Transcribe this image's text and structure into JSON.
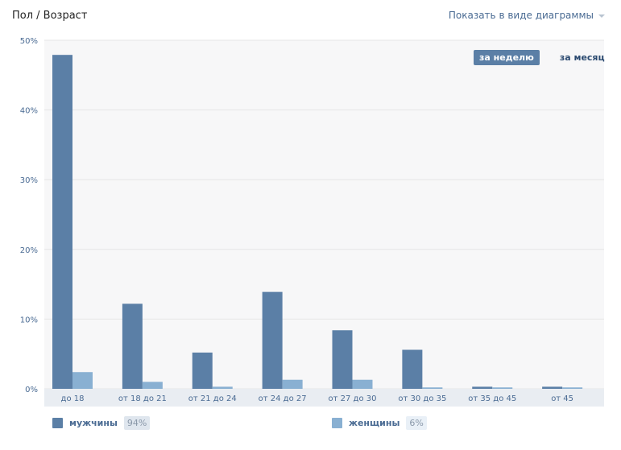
{
  "header": {
    "title": "Пол / Возраст",
    "view_toggle_label": "Показать в виде диаграммы"
  },
  "tabs": [
    {
      "label": "за неделю",
      "active": true
    },
    {
      "label": "за месяц",
      "active": false
    }
  ],
  "chart_data": {
    "type": "bar",
    "categories": [
      "до 18",
      "от 18 до 21",
      "от 21 до 24",
      "от 24 до 27",
      "от 27 до 30",
      "от 30 до 35",
      "от 35 до 45",
      "от 45"
    ],
    "series": [
      {
        "name": "мужчины",
        "values": [
          47.9,
          12.2,
          5.2,
          13.9,
          8.4,
          5.6,
          0.3,
          0.3
        ],
        "color": "#5b7fa6"
      },
      {
        "name": "женщины",
        "values": [
          2.4,
          1.0,
          0.3,
          1.3,
          1.3,
          0.2,
          0.2,
          0.2
        ],
        "color": "#89b0d2"
      }
    ],
    "y_ticks": [
      0,
      10,
      20,
      30,
      40,
      50
    ],
    "y_tick_labels": [
      "0%",
      "10%",
      "20%",
      "30%",
      "40%",
      "50%"
    ],
    "ylim": [
      0,
      50
    ],
    "grid": true,
    "colors": {
      "plot_background": "#f7f7f8",
      "axis_background": "#e9edf2",
      "grid": "#e6e6e6",
      "tick_text": "#4a6b93"
    }
  },
  "legend": [
    {
      "label": "мужчины",
      "share": "94%",
      "color": "#5b7fa6",
      "share_bg": "#dfe6ee"
    },
    {
      "label": "женщины",
      "share": "6%",
      "color": "#89b0d2",
      "share_bg": "#e9f0f7"
    }
  ]
}
